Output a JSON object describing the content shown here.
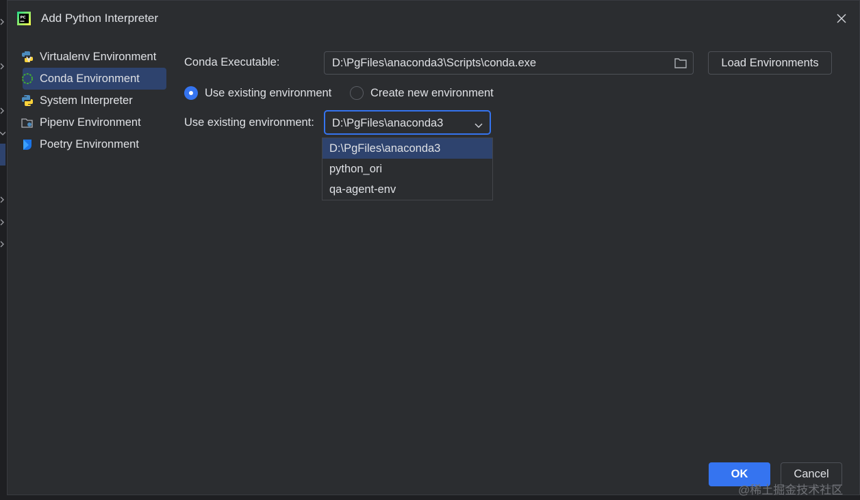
{
  "dialog": {
    "title": "Add Python Interpreter",
    "app_icon": "pycharm-icon"
  },
  "sidebar": {
    "items": [
      {
        "label": "Virtualenv Environment",
        "icon": "virtualenv-icon"
      },
      {
        "label": "Conda Environment",
        "icon": "conda-icon",
        "selected": true
      },
      {
        "label": "System Interpreter",
        "icon": "python-icon"
      },
      {
        "label": "Pipenv Environment",
        "icon": "pipenv-icon"
      },
      {
        "label": "Poetry Environment",
        "icon": "poetry-icon"
      }
    ]
  },
  "form": {
    "conda_executable_label": "Conda Executable:",
    "conda_executable_value": "D:\\PgFiles\\anaconda3\\Scripts\\conda.exe",
    "load_environments_label": "Load Environments",
    "radio_use_existing": "Use existing environment",
    "radio_create_new": "Create new environment",
    "selected_radio": "Use existing environment",
    "use_existing_label": "Use existing environment:",
    "env_combo_value": "D:\\PgFiles\\anaconda3",
    "env_options": [
      "D:\\PgFiles\\anaconda3",
      "python_ori",
      "qa-agent-env"
    ]
  },
  "footer": {
    "ok_label": "OK",
    "cancel_label": "Cancel"
  },
  "watermark": "@稀土掘金技术社区",
  "colors": {
    "accent": "#3574f0",
    "selection": "#2e436e",
    "dialog_bg": "#2b2d30"
  }
}
